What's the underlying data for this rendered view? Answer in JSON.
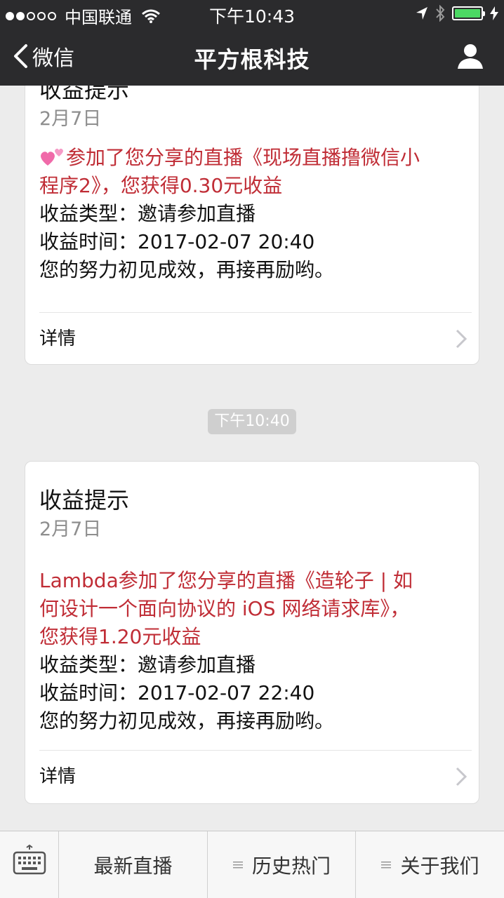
{
  "status_bar": {
    "carrier": "中国联通",
    "time": "下午10:43"
  },
  "nav": {
    "back_label": "微信",
    "title": "平方根科技"
  },
  "messages": [
    {
      "title": "收益提示",
      "date": "2月7日",
      "highlight_lines": [
        "参加了您分享的直播《现场直播撸微信小",
        "程序2》，您获得0.30元收益"
      ],
      "type_line": "收益类型：邀请参加直播",
      "time_line": "收益时间：2017-02-07 20:40",
      "closing_line": "您的努力初见成效，再接再励哟。",
      "details_label": "详情"
    },
    {
      "title": "收益提示",
      "date": "2月7日",
      "highlight_lines": [
        "Lambda参加了您分享的直播《造轮子 | 如",
        "何设计一个面向协议的 iOS 网络请求库》，",
        "您获得1.20元收益"
      ],
      "type_line": "收益类型：邀请参加直播",
      "time_line": "收益时间：2017-02-07 22:40",
      "closing_line": "您的努力初见成效，再接再励哟。",
      "details_label": "详情"
    }
  ],
  "time_separator": "下午10:40",
  "bottom_menu": {
    "items": [
      {
        "label": "最新直播",
        "has_submenu_icon": false
      },
      {
        "label": "历史热门",
        "has_submenu_icon": true
      },
      {
        "label": "关于我们",
        "has_submenu_icon": true
      }
    ]
  },
  "icons": [
    "signal-dots-icon",
    "wifi-icon",
    "location-arrow-icon",
    "bluetooth-icon",
    "battery-icon",
    "charging-bolt-icon",
    "back-chevron-icon",
    "profile-icon",
    "hearts-emoji-icon",
    "chevron-right-icon",
    "keyboard-icon",
    "menu-list-icon"
  ],
  "colors": {
    "bar_background": "#2b2b2d",
    "highlight_text": "#c02d36",
    "page_background": "#ececec",
    "battery_fill": "#4cd964"
  }
}
